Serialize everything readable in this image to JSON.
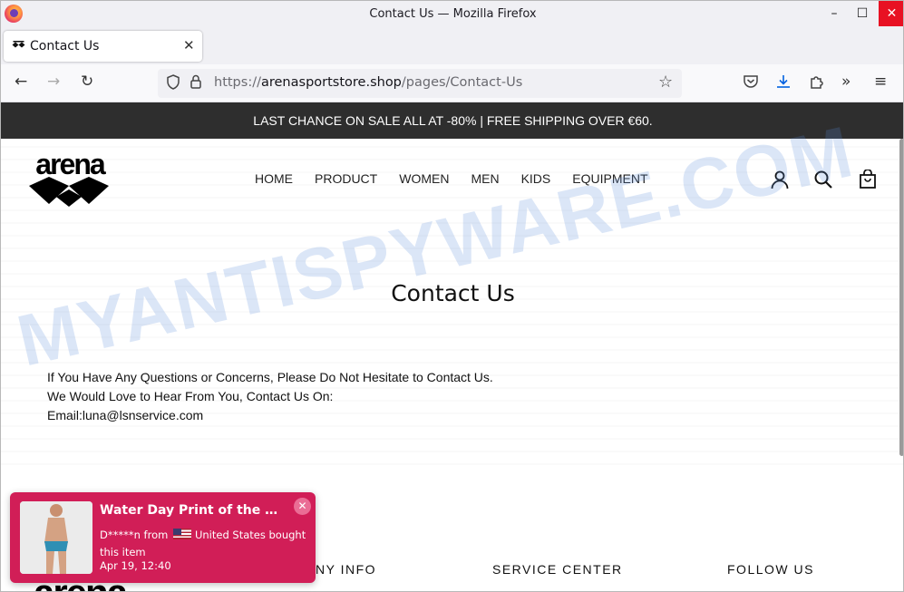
{
  "window": {
    "title": "Contact Us — Mozilla Firefox",
    "controls": {
      "minimize": "–",
      "maximize": "☐",
      "close": "✕"
    }
  },
  "tabs": [
    {
      "label": "Contact Us",
      "icon": "arena-favicon",
      "active": true
    }
  ],
  "tabstrip": {
    "new_tab": "+",
    "list_tabs": "⌄"
  },
  "navbar": {
    "back": "←",
    "forward": "→",
    "reload": "↻",
    "url_prefix": "https://",
    "url_domain": "arenasportstore.shop",
    "url_path": "/pages/Contact-Us",
    "icons": [
      "shield-icon",
      "lock-icon",
      "star-icon",
      "pocket-icon",
      "download-icon",
      "extensions-icon",
      "overflow-icon",
      "menu-icon"
    ],
    "overflow": "»",
    "menu": "≡"
  },
  "site": {
    "announcement": "LAST CHANCE ON SALE ALL AT -80% | FREE SHIPPING OVER €60.",
    "logo_text": "arena",
    "menu": [
      "HOME",
      "PRODUCT",
      "WOMEN",
      "MEN",
      "KIDS",
      "EQUIPMENT"
    ],
    "header_icons": [
      "account-icon",
      "search-icon",
      "cart-icon"
    ],
    "watermark": "MYANTISPYWARE.COM",
    "page_title": "Contact Us",
    "contact_lines": [
      "If You Have Any Questions or Concerns, Please Do Not Hesitate to Contact Us.",
      "We Would Love to Hear From You, Contact Us On:",
      "Email:luna@lsnservice.com"
    ],
    "footer_headings": [
      "NY INFO",
      "SERVICE CENTER",
      "FOLLOW US"
    ],
    "footer_logo_text": "arena"
  },
  "popup": {
    "title": "Water Day Print of the Mont...",
    "buyer": "D*****n from",
    "country": "United States bought",
    "suffix": "this item",
    "time": "Apr 19, 12:40",
    "close": "✕",
    "accent": "#d11e57"
  }
}
